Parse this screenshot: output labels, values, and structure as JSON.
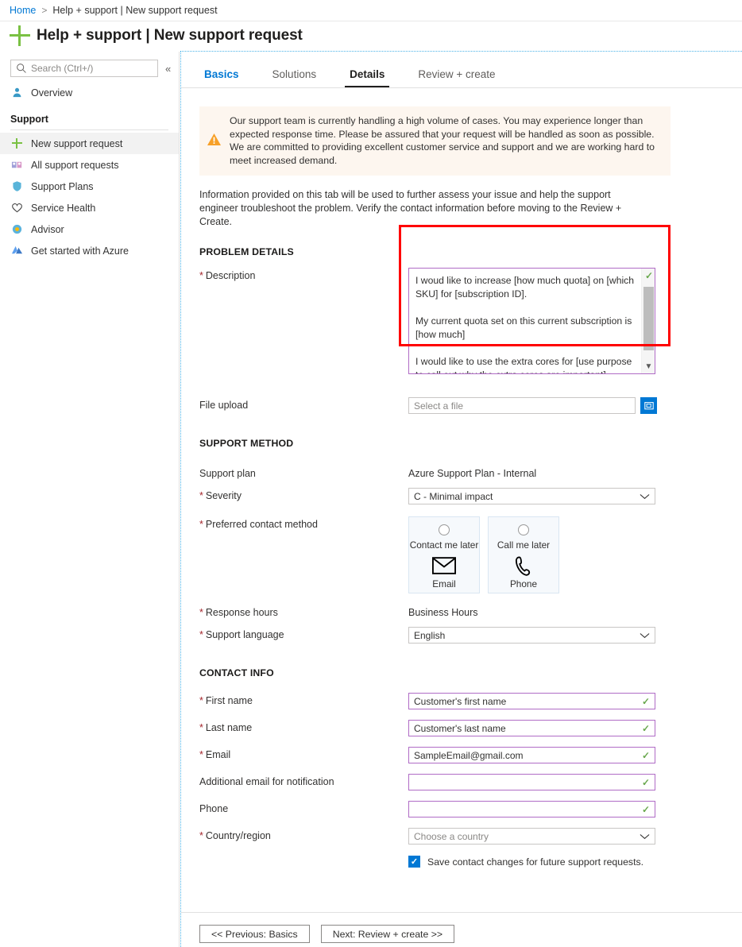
{
  "breadcrumb": {
    "home": "Home",
    "separator": ">",
    "current": "Help + support | New support request"
  },
  "header": {
    "title": "Help + support | New support request",
    "icon": "plus-icon"
  },
  "sidebar": {
    "search": {
      "placeholder": "Search (Ctrl+/)",
      "icon": "search-icon"
    },
    "collapse_icon": "«",
    "top_items": [
      {
        "label": "Overview",
        "icon": "person-icon"
      }
    ],
    "group_label": "Support",
    "items": [
      {
        "label": "New support request",
        "icon": "plus-icon",
        "selected": true
      },
      {
        "label": "All support requests",
        "icon": "requests-icon",
        "selected": false
      },
      {
        "label": "Support Plans",
        "icon": "shield-icon",
        "selected": false
      },
      {
        "label": "Service Health",
        "icon": "heart-pulse-icon",
        "selected": false
      },
      {
        "label": "Advisor",
        "icon": "advisor-icon",
        "selected": false
      },
      {
        "label": "Get started with Azure",
        "icon": "azure-icon",
        "selected": false
      }
    ]
  },
  "tabs": [
    {
      "label": "Basics",
      "state": "visited"
    },
    {
      "label": "Solutions",
      "state": "normal"
    },
    {
      "label": "Details",
      "state": "active"
    },
    {
      "label": "Review + create",
      "state": "normal"
    }
  ],
  "banner": {
    "icon": "warning-icon",
    "text": "Our support team is currently handling a high volume of cases. You may experience longer than expected response time. Please be assured that your request will be handled as soon as possible. We are committed to providing excellent customer service and support and we are working hard to meet increased demand."
  },
  "intro": "Information provided on this tab will be used to further assess your issue and help the support engineer troubleshoot the problem. Verify the contact information before moving to the Review + Create.",
  "problem_details": {
    "heading": "PROBLEM DETAILS",
    "description": {
      "label": "Description",
      "required": true,
      "paragraphs": [
        "I woud like to increase [how much quota] on [which SKU] for [subscription ID].",
        "My current quota set on this current subscription is [how much]",
        "I would like to use the extra cores for [use purpose to call out why the extra cores are important]"
      ],
      "validation_icon": "green-check-icon",
      "scrollbar_down_icon": "chevron-down-icon"
    },
    "file_upload": {
      "label": "File upload",
      "required": false,
      "placeholder": "Select a file",
      "button_icon": "folder-open-icon"
    }
  },
  "support_method": {
    "heading": "SUPPORT METHOD",
    "support_plan": {
      "label": "Support plan",
      "required": false,
      "value": "Azure Support Plan - Internal"
    },
    "severity": {
      "label": "Severity",
      "required": true,
      "value": "C - Minimal impact",
      "chevron": "chevron-down-icon"
    },
    "preferred_contact_method": {
      "label": "Preferred contact method",
      "required": true,
      "options": [
        {
          "title": "Contact me later",
          "sub": "Email",
          "icon": "envelope-icon",
          "selected": false
        },
        {
          "title": "Call me later",
          "sub": "Phone",
          "icon": "phone-icon",
          "selected": false
        }
      ]
    },
    "response_hours": {
      "label": "Response hours",
      "required": true,
      "value": "Business Hours"
    },
    "support_language": {
      "label": "Support language",
      "required": true,
      "value": "English",
      "chevron": "chevron-down-icon"
    }
  },
  "contact_info": {
    "heading": "CONTACT INFO",
    "fields": [
      {
        "label": "First name",
        "required": true,
        "value": "Customer's first name",
        "validated": true,
        "type": "text"
      },
      {
        "label": "Last name",
        "required": true,
        "value": "Customer's last name",
        "validated": true,
        "type": "text"
      },
      {
        "label": "Email",
        "required": true,
        "value": "SampleEmail@gmail.com",
        "validated": true,
        "type": "text"
      },
      {
        "label": "Additional email for notification",
        "required": false,
        "value": "",
        "validated": true,
        "type": "text"
      },
      {
        "label": "Phone",
        "required": false,
        "value": "",
        "validated": true,
        "type": "text"
      },
      {
        "label": "Country/region",
        "required": true,
        "value": "Choose a country",
        "validated": false,
        "type": "select"
      }
    ],
    "save_checkbox": {
      "label": "Save contact changes for future support requests.",
      "checked": true
    }
  },
  "footer": {
    "previous_label": "<< Previous: Basics",
    "next_label": "Next: Review + create >>"
  },
  "colors": {
    "accent_blue": "#0078d4",
    "highlight_red": "#ff0000",
    "validated_purple": "#b06cc6",
    "check_green": "#6aa84f",
    "required_red": "#a4262c",
    "plus_green": "#7ac143"
  }
}
